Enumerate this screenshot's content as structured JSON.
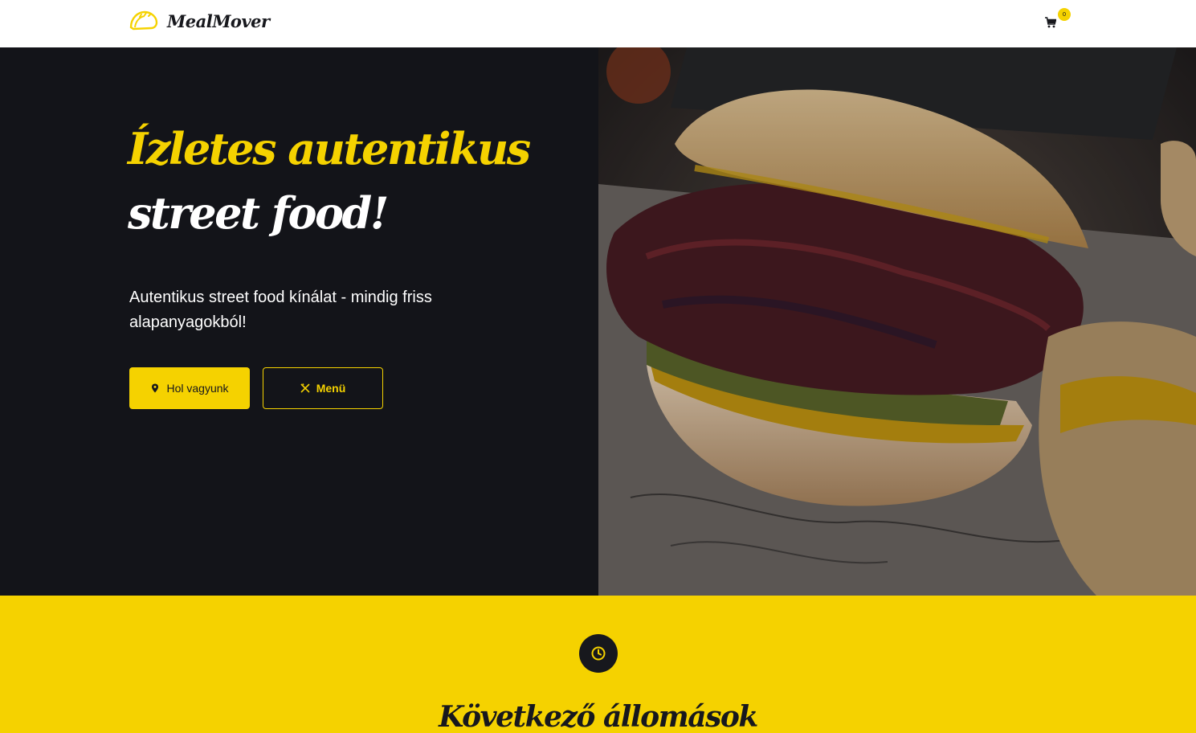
{
  "nav": {
    "brand": "MealMover",
    "cart_count": "0"
  },
  "hero": {
    "title_line1": "Ízletes autentikus",
    "title_line2": "street food!",
    "subtitle": "Autentikus street food kínálat - mindig friss alapanyagokból!",
    "buttons": {
      "where": "Hol vagyunk",
      "menu": "Menü"
    },
    "image_alt": "burger-photo"
  },
  "stops": {
    "title": "Következő állomások"
  },
  "colors": {
    "accent": "#f5d200",
    "dark": "#131419",
    "text_dark": "#17181d",
    "white": "#ffffff"
  },
  "icons": {
    "logo": "taco-icon",
    "cart": "cart-icon",
    "where": "map-pin-icon",
    "menu": "utensils-icon",
    "clock": "clock-icon"
  }
}
